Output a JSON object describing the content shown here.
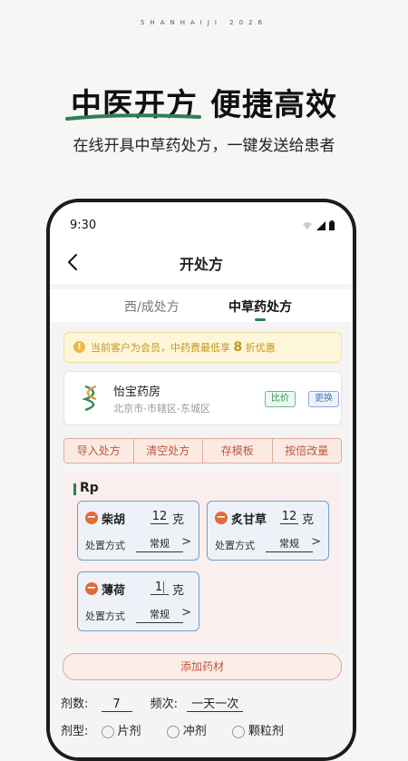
{
  "brand": "SHANHAIJI 2026",
  "headline": {
    "part1": "中医开方",
    "part2": "便捷高效"
  },
  "subline": "在线开具中草药处方，一键发送给患者",
  "colors": {
    "accent_green": "#2e7d5b",
    "action_red": "#c0563c",
    "notice_gold": "#c59422",
    "herb_border": "#6e9fce"
  },
  "status": {
    "time": "9:30",
    "icons": [
      "wifi-icon",
      "signal-icon",
      "battery-icon"
    ]
  },
  "nav": {
    "title": "开处方",
    "back_icon": "chevron-left-icon"
  },
  "tabs": [
    {
      "label": "西/成处方",
      "active": false
    },
    {
      "label": "中草药处方",
      "active": true
    }
  ],
  "notice": {
    "pre": "当前客户为会员，中药费最低享",
    "discount": "8",
    "post": "折优惠",
    "icon": "exclamation-icon"
  },
  "pharmacy": {
    "name": "怡宝药房",
    "address": "北京市-市辖区-东城区",
    "compare_label": "比价",
    "change_label": "更换"
  },
  "actions": [
    "导入处方",
    "清空处方",
    "存模板",
    "按倍改量"
  ],
  "rp": {
    "label": "Rp",
    "herbs": [
      {
        "name": "柴胡",
        "qty": "12",
        "unit": "克",
        "method_label": "处置方式",
        "method": "常规"
      },
      {
        "name": "炙甘草",
        "qty": "12",
        "unit": "克",
        "method_label": "处置方式",
        "method": "常规"
      },
      {
        "name": "薄荷",
        "qty": "1",
        "unit": "克",
        "method_label": "处置方式",
        "method": "常规"
      }
    ]
  },
  "add_herb_label": "添加药材",
  "dosage": {
    "label": "剂数:",
    "value": "7",
    "freq_label": "频次:",
    "freq_value": "一天一次"
  },
  "form": {
    "label": "剂型:",
    "options": [
      "片剂",
      "冲剂",
      "颗粒剂"
    ]
  }
}
